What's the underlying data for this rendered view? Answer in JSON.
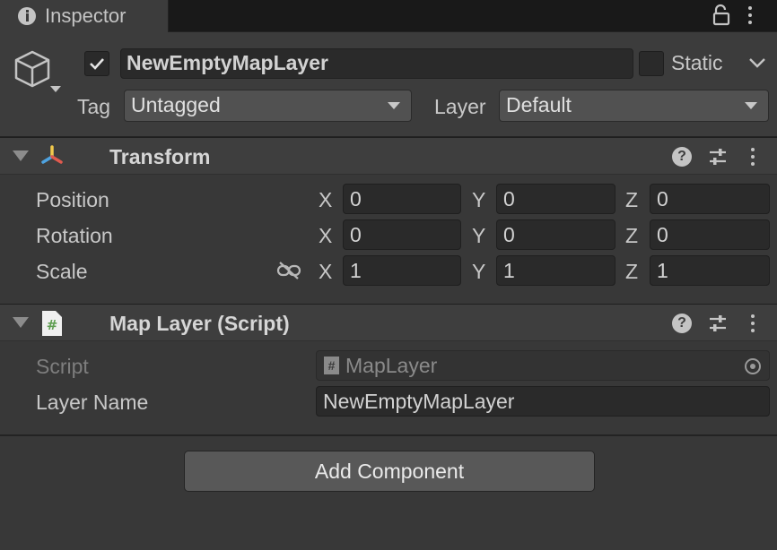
{
  "tab": {
    "title": "Inspector",
    "icon": "info-icon"
  },
  "header": {
    "object_name": "NewEmptyMapLayer",
    "static_label": "Static",
    "tag_label": "Tag",
    "tag_value": "Untagged",
    "layer_label": "Layer",
    "layer_value": "Default",
    "active": true,
    "static": false
  },
  "transform": {
    "title": "Transform",
    "rows": [
      {
        "label": "Position",
        "x": "0",
        "y": "0",
        "z": "0"
      },
      {
        "label": "Rotation",
        "x": "0",
        "y": "0",
        "z": "0"
      },
      {
        "label": "Scale",
        "x": "1",
        "y": "1",
        "z": "1"
      }
    ],
    "axis": {
      "x": "X",
      "y": "Y",
      "z": "Z"
    }
  },
  "map_layer": {
    "title": "Map Layer (Script)",
    "script_label": "Script",
    "script_value": "MapLayer",
    "layer_name_label": "Layer Name",
    "layer_name_value": "NewEmptyMapLayer"
  },
  "add_component_label": "Add Component",
  "colors": {
    "background": "#383838",
    "header_bg": "#3c3c3c",
    "field_bg": "#2a2a2a",
    "text": "#d2d2d2",
    "script_icon": "#5f9e52"
  }
}
